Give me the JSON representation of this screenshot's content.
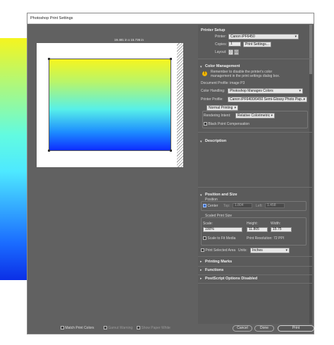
{
  "window": {
    "title": "Photoshop Print Settings"
  },
  "preview": {
    "paper_dimensions": "19.481 in x 15.736 in"
  },
  "bottom": {
    "match_print_colors": "Match Print Colors",
    "gamut_warning": "Gamut Warning",
    "show_paper_white": "Show Paper White",
    "cancel": "Cancel",
    "done": "Done",
    "print": "Print"
  },
  "printer_setup": {
    "heading": "Printer Setup",
    "printer_label": "Printer:",
    "printer_value": "Canon iPF6450",
    "copies_label": "Copies:",
    "copies_value": "1",
    "print_settings_btn": "Print Settings...",
    "layout_label": "Layout:"
  },
  "color_management": {
    "heading": "Color Management",
    "warning_text_1": "Remember to disable the printer's color",
    "warning_text_2": "management in the print settings dialog box.",
    "document_profile": "Document Profile: image P3",
    "color_handling_label": "Color Handling:",
    "color_handling_value": "Photoshop Manages Colors",
    "printer_profile_label": "Printer Profile:",
    "printer_profile_value": "Canon iPF6400/6450 Semi-Glossy Photo Pap...",
    "printing_mode": "Normal Printing",
    "rendering_intent_label": "Rendering Intent:",
    "rendering_intent_value": "Relative Colorimetric",
    "black_point": "Black Point Compensation"
  },
  "description": {
    "heading": "Description"
  },
  "position_size": {
    "heading": "Position and Size",
    "position_label": "Position",
    "center": "Center",
    "top_label": "Top:",
    "top_value": "1.804",
    "left_label": "Left:",
    "left_value": "1.458",
    "scaled_label": "Scaled Print Size",
    "scale_label": "Scale:",
    "scale_value": "100%",
    "height_label": "Height:",
    "height_value": "11.805",
    "width_label": "Width:",
    "width_value": "15.75",
    "scale_to_fit": "Scale to Fit Media",
    "print_resolution": "Print Resolution: 72 PPI",
    "print_selected": "Print Selected Area",
    "units_label": "Units:",
    "units_value": "Inches"
  },
  "collapsed_sections": {
    "printing_marks": "Printing Marks",
    "functions": "Functions",
    "postscript": "PostScript Options Disabled"
  }
}
